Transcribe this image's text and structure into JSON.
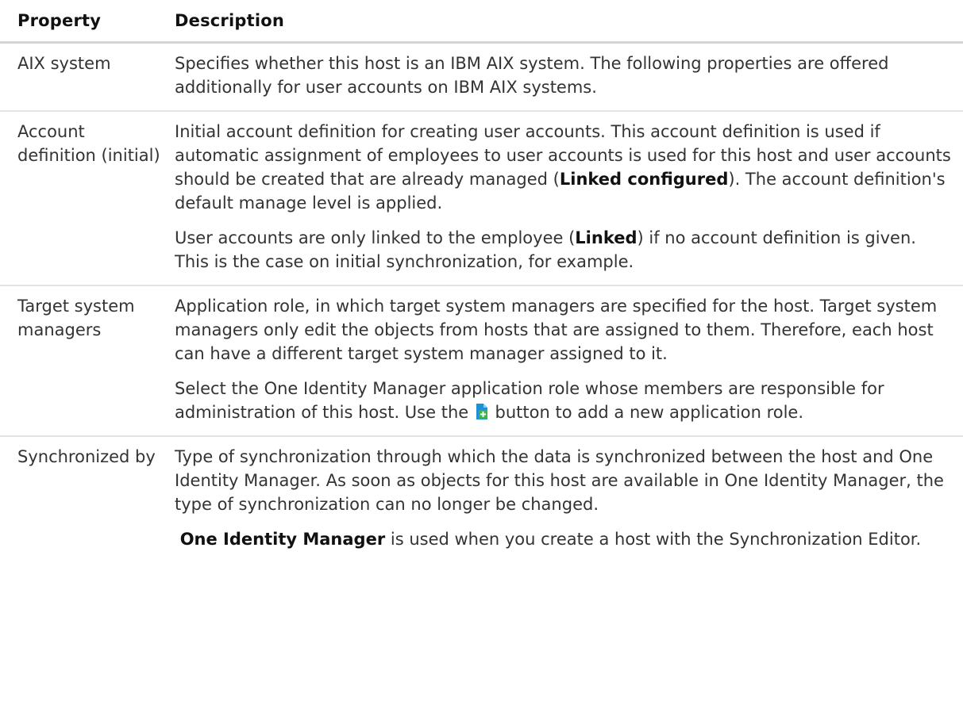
{
  "header": {
    "property": "Property",
    "description": "Description"
  },
  "rows": [
    {
      "property": "AIX system",
      "p1": "Specifies whether this host is an IBM AIX system. The following properties are offered additionally for user accounts on IBM AIX systems."
    },
    {
      "property": "Account definition (initial)",
      "p1_a": "Initial account definition for creating user accounts. This account definition is used if automatic assignment of employees to user accounts is used for this host and user accounts should be created that are already managed (",
      "p1_bold": "Linked configured",
      "p1_b": "). The account definition's default manage level is applied.",
      "p2_a": "User accounts are only linked to the employee (",
      "p2_bold": "Linked",
      "p2_b": ") if no account definition is given. This is the case on initial synchronization, for example."
    },
    {
      "property": "Target system managers",
      "p1": "Application role, in which target system managers are specified for the host. Target system managers only edit the objects from hosts that are assigned to them. Therefore, each host can have a different target system manager assigned to it.",
      "p2_a": "Select the One Identity Manager application role whose members are responsible for administration of this host. Use the ",
      "p2_icon": "add-document-icon",
      "p2_b": " button to add a new application role."
    },
    {
      "property": "Synchronized by",
      "p1": "Type of synchronization through which the data is synchronized between the host and One Identity Manager. As soon as objects for this host are available in One Identity Manager, the type of synchronization can no longer be changed.",
      "p2_bold": "One Identity Manager",
      "p2_b": " is used when you create a host with the Synchronization Editor."
    }
  ],
  "colors": {
    "icon_blue": "#1e90d6",
    "icon_green": "#3fb24a",
    "rule": "#d4d4d4"
  }
}
